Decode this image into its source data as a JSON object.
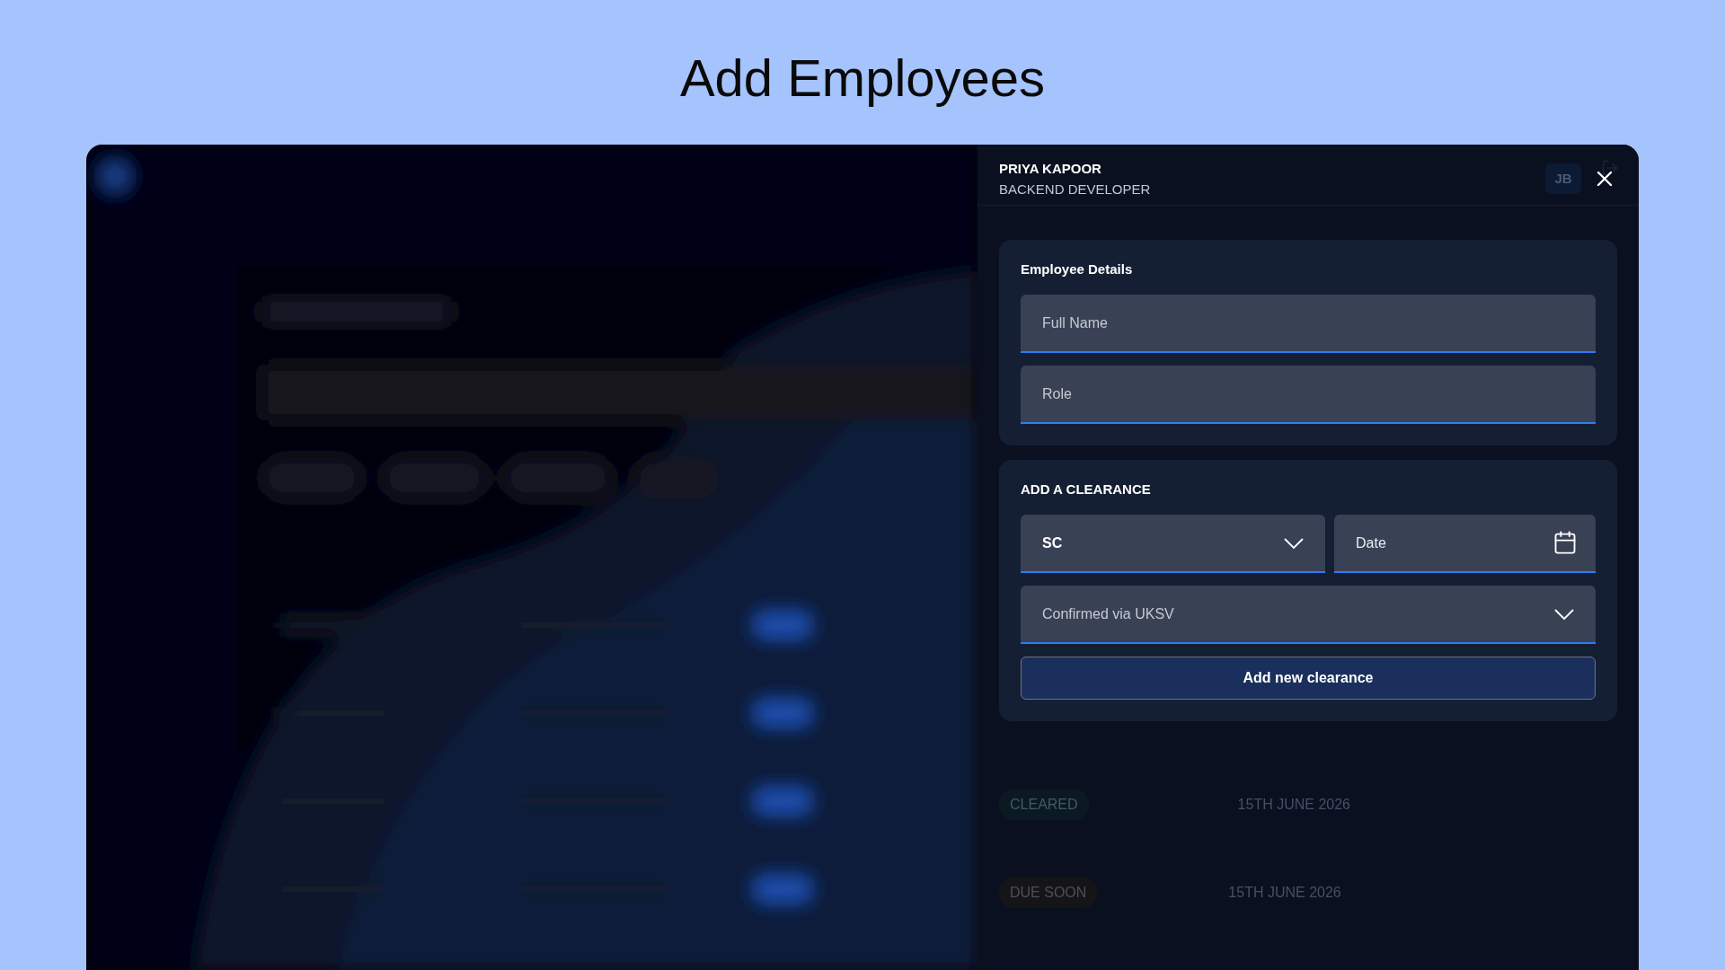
{
  "page_title": "Add Employees",
  "drawer": {
    "employee_name": "PRIYA KAPOOR",
    "employee_role": "BACKEND DEVELOPER",
    "avatar_initials": "JB",
    "details": {
      "title": "Employee Details",
      "fields": [
        {
          "placeholder": "Full Name"
        },
        {
          "placeholder": "Role"
        }
      ]
    },
    "clearance": {
      "title": "ADD A CLEARANCE",
      "level": {
        "value": "SC"
      },
      "date": {
        "placeholder": "Date"
      },
      "status": {
        "value": "Confirmed via UKSV"
      },
      "button": "Add new clearance"
    }
  },
  "background_rows": [
    {
      "kind": "cleared",
      "status": "CLEARED",
      "date": "15TH JUNE 2026"
    },
    {
      "kind": "due",
      "status": "DUE SOON",
      "date": "15TH JUNE 2026"
    }
  ]
}
